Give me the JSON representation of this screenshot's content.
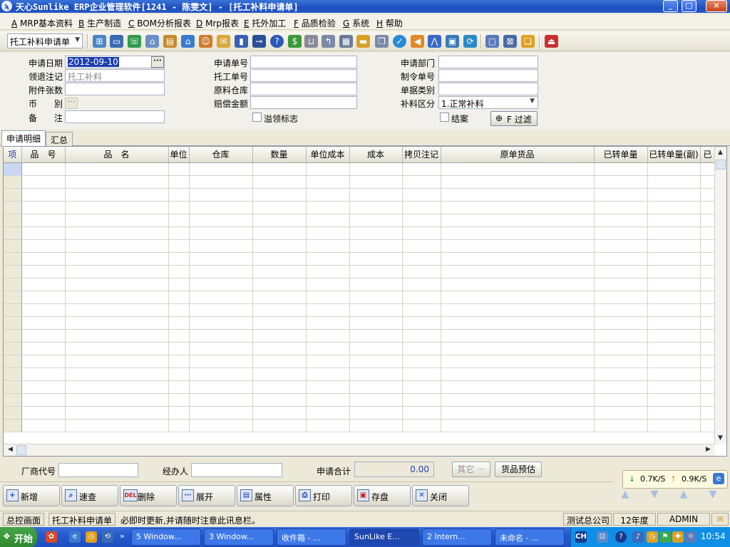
{
  "window": {
    "title": "天心Sunlike ERP企业管理软件[1241 - 陈雯文] - [托工补料申请单]",
    "buttons": [
      "_",
      "□",
      "×"
    ]
  },
  "menu": [
    {
      "key": "A",
      "label": "MRP基本资料"
    },
    {
      "key": "B",
      "label": "生产制造"
    },
    {
      "key": "C",
      "label": "BOM分析报表"
    },
    {
      "key": "D",
      "label": "Mrp报表"
    },
    {
      "key": "E",
      "label": "托外加工"
    },
    {
      "key": "F",
      "label": "品质检验"
    },
    {
      "key": "G",
      "label": "系统"
    },
    {
      "key": "H",
      "label": "帮助"
    }
  ],
  "toolbar": {
    "doc_type": "托工补料申请单",
    "icons": [
      "tree-icon",
      "monitor-icon",
      "phone-icon",
      "house-key-icon",
      "briefcase-icon",
      "home-icon",
      "people-icon",
      "mail-icon",
      "book-icon",
      "key-icon",
      "help-icon",
      "dollar-icon",
      "cart-icon",
      "curve-icon",
      "calculator-icon",
      "archive-icon",
      "copy-icon",
      "check-icon",
      "bell-icon",
      "network-icon",
      "screen-icon",
      "refresh-icon",
      "window-icon",
      "close-window-icon",
      "windows-icon",
      "exit-icon"
    ]
  },
  "form": {
    "apply_date_label": "申请日期",
    "apply_date": "2012-09-10",
    "ref_note_label": "领退注记",
    "ref_note": "托工补料",
    "attach_label": "附件张数",
    "attach": "",
    "currency_label": "币　　别",
    "remark_label": "备　　注",
    "remark": "",
    "apply_no_label": "申请单号",
    "apply_no": "",
    "outsource_no_label": "托工单号",
    "outsource_no": "",
    "raw_wh_label": "原料仓库",
    "raw_wh": "",
    "compensation_label": "赔偿金额",
    "compensation": "",
    "overdraw_label": "溢领标志",
    "dept_label": "申请部门",
    "dept": "",
    "order_no_label": "制令单号",
    "order_no": "",
    "doc_class_label": "单据类别",
    "doc_class": "",
    "supply_type_label": "补料区分",
    "supply_type": "1.正常补料",
    "closed_label": "结案",
    "filter_label": "F 过滤"
  },
  "tabs": [
    "申请明细",
    "汇总"
  ],
  "grid": {
    "columns": [
      "项",
      "品　号",
      "品　名",
      "单位",
      "仓库",
      "数量",
      "单位成本",
      "成本",
      "拷贝注记",
      "原单货品",
      "已转单量",
      "已转单量(副)",
      "已"
    ],
    "row_count": 21
  },
  "footer": {
    "vendor_label": "厂商代号",
    "vendor": "",
    "handler_label": "经办人",
    "handler": "",
    "total_label": "申请合计",
    "total": "0.00",
    "other_label": "其它",
    "preview_label": "货品预估"
  },
  "actions": [
    {
      "label": "新增",
      "icon": "add-icon"
    },
    {
      "label": "速查",
      "icon": "search-icon"
    },
    {
      "label": "删除",
      "icon": "delete-icon"
    },
    {
      "label": "展开",
      "icon": "expand-icon"
    },
    {
      "label": "属性",
      "icon": "properties-icon"
    },
    {
      "label": "打印",
      "icon": "print-icon"
    },
    {
      "label": "存盘",
      "icon": "save-icon"
    },
    {
      "label": "关闭",
      "icon": "close-icon"
    }
  ],
  "network": {
    "down": "0.7K/S",
    "up": "0.9K/S"
  },
  "status": {
    "home": "总控画面",
    "doc": "托工补料申请单",
    "message": "必即时更新,并请随时注意此讯息栏。",
    "company": "测试总公司",
    "year": "12年度",
    "user": "ADMIN"
  },
  "taskbar": {
    "start": "开始",
    "tasks": [
      "5 Window...",
      "3 Window...",
      "收件箱 - ...",
      "SunLike E...",
      "2 Intern...",
      "未命名 - ..."
    ],
    "lang": "CH",
    "time": "10:54"
  }
}
